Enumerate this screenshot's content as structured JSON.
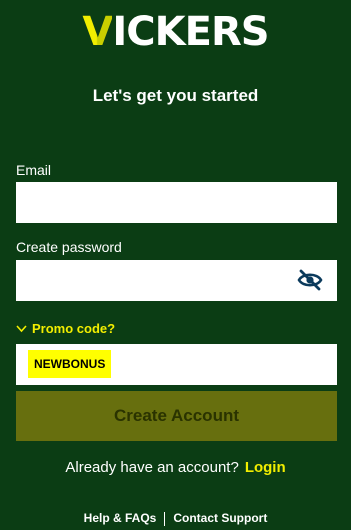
{
  "brand": {
    "logo_first": "V",
    "logo_rest": "ICKERS"
  },
  "page": {
    "subtitle": "Let's get you started"
  },
  "form": {
    "email_label": "Email",
    "email_value": "",
    "password_label": "Create password",
    "password_value": "",
    "password_toggle_icon": "eye-slash-icon",
    "promo_toggle_label": "Promo code?",
    "promo_value": "NEWBONUS",
    "submit_label": "Create Account"
  },
  "login_prompt": {
    "text": "Already have an account?",
    "link": "Login"
  },
  "footer": {
    "help": "Help & FAQs",
    "support": "Contact Support"
  },
  "colors": {
    "background": "#0b3d14",
    "accent": "#f2ee00",
    "button": "#676f0e",
    "highlight": "#ffff00"
  }
}
